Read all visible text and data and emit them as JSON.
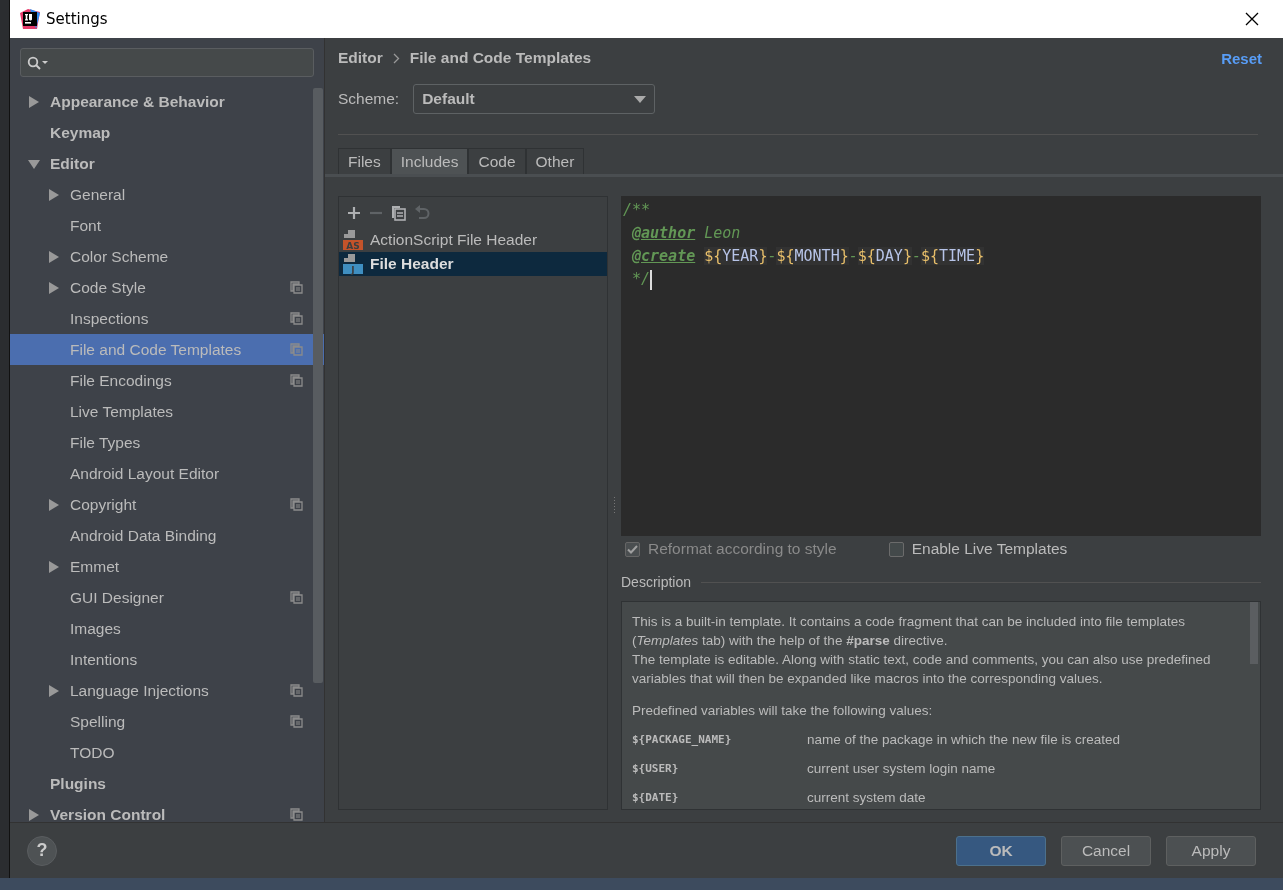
{
  "window": {
    "title": "Settings"
  },
  "sidebar": {
    "items": [
      {
        "label": "Appearance & Behavior",
        "expanded": false,
        "selected": false,
        "project_scope": false
      },
      {
        "label": "Keymap",
        "selected": false,
        "project_scope": false
      },
      {
        "label": "Editor",
        "expanded": true,
        "selected": false,
        "project_scope": false,
        "children": [
          {
            "label": "General",
            "expanded": false,
            "selected": false,
            "project_scope": false
          },
          {
            "label": "Font",
            "selected": false,
            "project_scope": false
          },
          {
            "label": "Color Scheme",
            "expanded": false,
            "selected": false,
            "project_scope": false
          },
          {
            "label": "Code Style",
            "expanded": false,
            "selected": false,
            "project_scope": true
          },
          {
            "label": "Inspections",
            "selected": false,
            "project_scope": true
          },
          {
            "label": "File and Code Templates",
            "selected": true,
            "project_scope": true
          },
          {
            "label": "File Encodings",
            "selected": false,
            "project_scope": true
          },
          {
            "label": "Live Templates",
            "selected": false,
            "project_scope": false
          },
          {
            "label": "File Types",
            "selected": false,
            "project_scope": false
          },
          {
            "label": "Android Layout Editor",
            "selected": false,
            "project_scope": false
          },
          {
            "label": "Copyright",
            "expanded": false,
            "selected": false,
            "project_scope": true
          },
          {
            "label": "Android Data Binding",
            "selected": false,
            "project_scope": false
          },
          {
            "label": "Emmet",
            "expanded": false,
            "selected": false,
            "project_scope": false
          },
          {
            "label": "GUI Designer",
            "selected": false,
            "project_scope": true
          },
          {
            "label": "Images",
            "selected": false,
            "project_scope": false
          },
          {
            "label": "Intentions",
            "selected": false,
            "project_scope": false
          },
          {
            "label": "Language Injections",
            "expanded": false,
            "selected": false,
            "project_scope": true
          },
          {
            "label": "Spelling",
            "selected": false,
            "project_scope": true
          },
          {
            "label": "TODO",
            "selected": false,
            "project_scope": false
          }
        ]
      },
      {
        "label": "Plugins",
        "selected": false,
        "project_scope": false
      },
      {
        "label": "Version Control",
        "expanded": false,
        "selected": false,
        "project_scope": true
      }
    ]
  },
  "breadcrumb": [
    "Editor",
    "File and Code Templates"
  ],
  "reset_link": "Reset",
  "scheme": {
    "label": "Scheme:",
    "value": "Default"
  },
  "tabs": [
    {
      "label": "Files",
      "selected": false
    },
    {
      "label": "Includes",
      "selected": true
    },
    {
      "label": "Code",
      "selected": false
    },
    {
      "label": "Other",
      "selected": false
    }
  ],
  "toolbar": [
    {
      "kind": "add",
      "disabled": false
    },
    {
      "kind": "remove",
      "disabled": true
    },
    {
      "kind": "copy",
      "disabled": false
    },
    {
      "kind": "revert",
      "disabled": true
    }
  ],
  "templates": [
    {
      "name": "ActionScript File Header",
      "badge": "AS",
      "kind": "actionscript",
      "selected": false
    },
    {
      "name": "File Header",
      "badge": "J",
      "kind": "java",
      "selected": true
    }
  ],
  "editor": {
    "lines": [
      [
        {
          "kind": "comment",
          "text": "/**"
        }
      ],
      [
        {
          "kind": "tag",
          "text": "@author",
          "space_before": true
        },
        {
          "kind": "comment",
          "text": "Leon",
          "space_before": true
        }
      ],
      [
        {
          "kind": "tag",
          "text": "@create",
          "space_before": true
        },
        {
          "kind": "brace",
          "text": "${",
          "space_before": true
        },
        {
          "kind": "var",
          "text": "YEAR"
        },
        {
          "kind": "brace",
          "text": "}"
        },
        {
          "kind": "comment",
          "text": "-"
        },
        {
          "kind": "brace",
          "text": "${"
        },
        {
          "kind": "var",
          "text": "MONTH"
        },
        {
          "kind": "brace",
          "text": "}"
        },
        {
          "kind": "comment",
          "text": "-"
        },
        {
          "kind": "brace",
          "text": "${"
        },
        {
          "kind": "var",
          "text": "DAY"
        },
        {
          "kind": "brace",
          "text": "}"
        },
        {
          "kind": "comment",
          "text": "-"
        },
        {
          "kind": "brace",
          "text": "${"
        },
        {
          "kind": "var",
          "text": "TIME"
        },
        {
          "kind": "brace",
          "text": "}"
        }
      ],
      [
        {
          "kind": "comment",
          "text": " */"
        }
      ]
    ]
  },
  "options": [
    {
      "label": "Reformat according to style",
      "checked": true,
      "disabled": true
    },
    {
      "label": "Enable Live Templates",
      "checked": false,
      "disabled": false
    }
  ],
  "description": {
    "heading": "Description",
    "paragraphs": [
      "This is a built-in template. It contains a code fragment that can be included into file templates (*Templates* tab) with the help of the **#parse** directive.",
      "The template is editable. Along with static text, code and comments, you can also use predefined variables that will then be expanded like macros into the corresponding values."
    ],
    "variables_intro": "Predefined variables will take the following values:",
    "variables": [
      {
        "name": "${PACKAGE_NAME}",
        "meaning": "name of the package in which the new file is created"
      },
      {
        "name": "${USER}",
        "meaning": "current user system login name"
      },
      {
        "name": "${DATE}",
        "meaning": "current system date"
      }
    ]
  },
  "buttons": [
    {
      "label": "OK",
      "kind": "default"
    },
    {
      "label": "Cancel",
      "kind": "normal"
    },
    {
      "label": "Apply",
      "kind": "normal"
    }
  ],
  "help": "?"
}
